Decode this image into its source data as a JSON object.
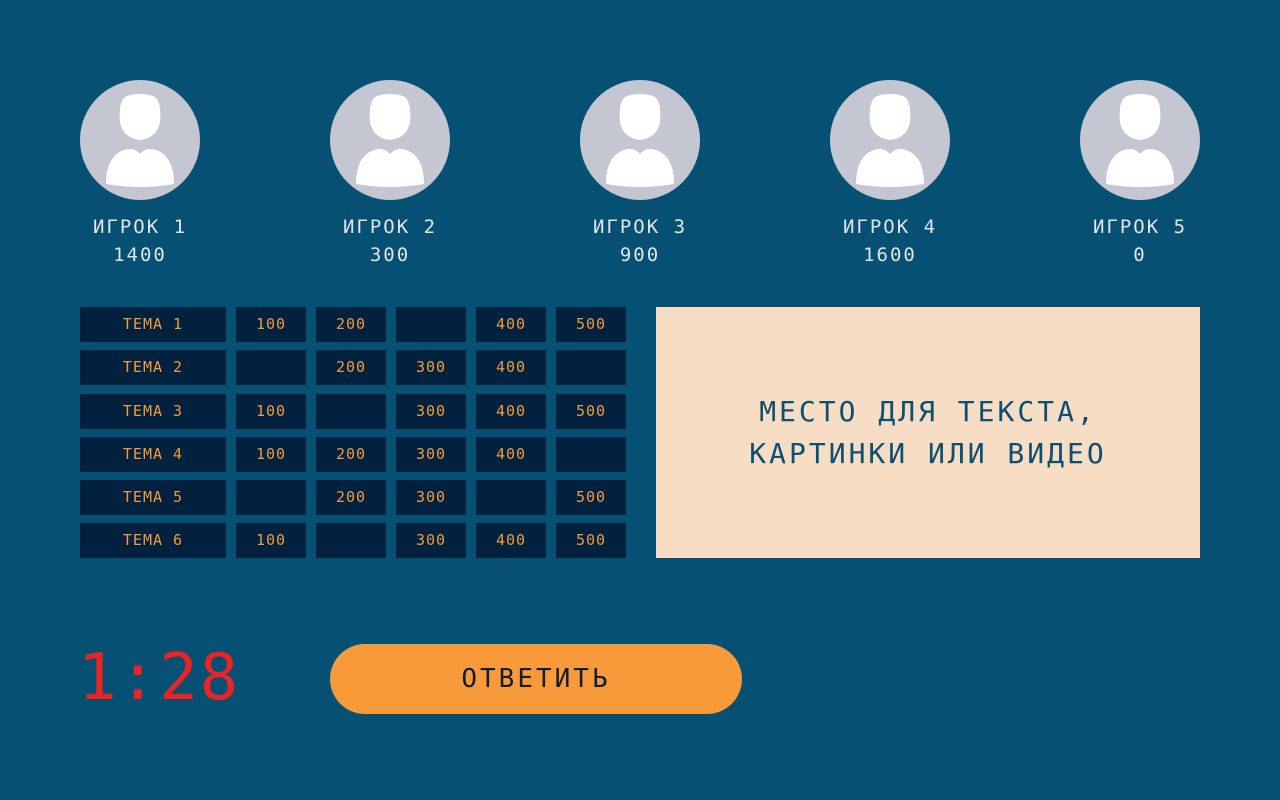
{
  "players": [
    {
      "name": "ИГРОК 1",
      "score": "1400",
      "avatar_icon": "user-silhouette-icon"
    },
    {
      "name": "ИГРОК 2",
      "score": "300",
      "avatar_icon": "user-silhouette-icon"
    },
    {
      "name": "ИГРОК 3",
      "score": "900",
      "avatar_icon": "user-silhouette-icon"
    },
    {
      "name": "ИГРОК 4",
      "score": "1600",
      "avatar_icon": "user-silhouette-icon"
    },
    {
      "name": "ИГРОК 5",
      "score": "0",
      "avatar_icon": "user-silhouette-icon"
    }
  ],
  "board": {
    "rows": [
      {
        "topic": "ТЕМА 1",
        "cells": [
          "100",
          "200",
          "",
          "400",
          "500"
        ]
      },
      {
        "topic": "ТЕМА 2",
        "cells": [
          "",
          "200",
          "300",
          "400",
          ""
        ]
      },
      {
        "topic": "ТЕМА 3",
        "cells": [
          "100",
          "",
          "300",
          "400",
          "500"
        ]
      },
      {
        "topic": "ТЕМА 4",
        "cells": [
          "100",
          "200",
          "300",
          "400",
          ""
        ]
      },
      {
        "topic": "ТЕМА 5",
        "cells": [
          "",
          "200",
          "300",
          "",
          "500"
        ]
      },
      {
        "topic": "ТЕМА 6",
        "cells": [
          "100",
          "",
          "300",
          "400",
          "500"
        ]
      }
    ]
  },
  "display": {
    "line1": "МЕСТО ДЛЯ ТЕКСТА,",
    "line2": "КАРТИНКИ ИЛИ ВИДЕО"
  },
  "timer": "1:28",
  "answer_button": "ОТВЕТИТЬ",
  "colors": {
    "background": "#065073",
    "cell": "#02213f",
    "cell_text": "#f39a3a",
    "display_bg": "#f6ddc3",
    "timer": "#ea2323",
    "button": "#f89a3a"
  }
}
